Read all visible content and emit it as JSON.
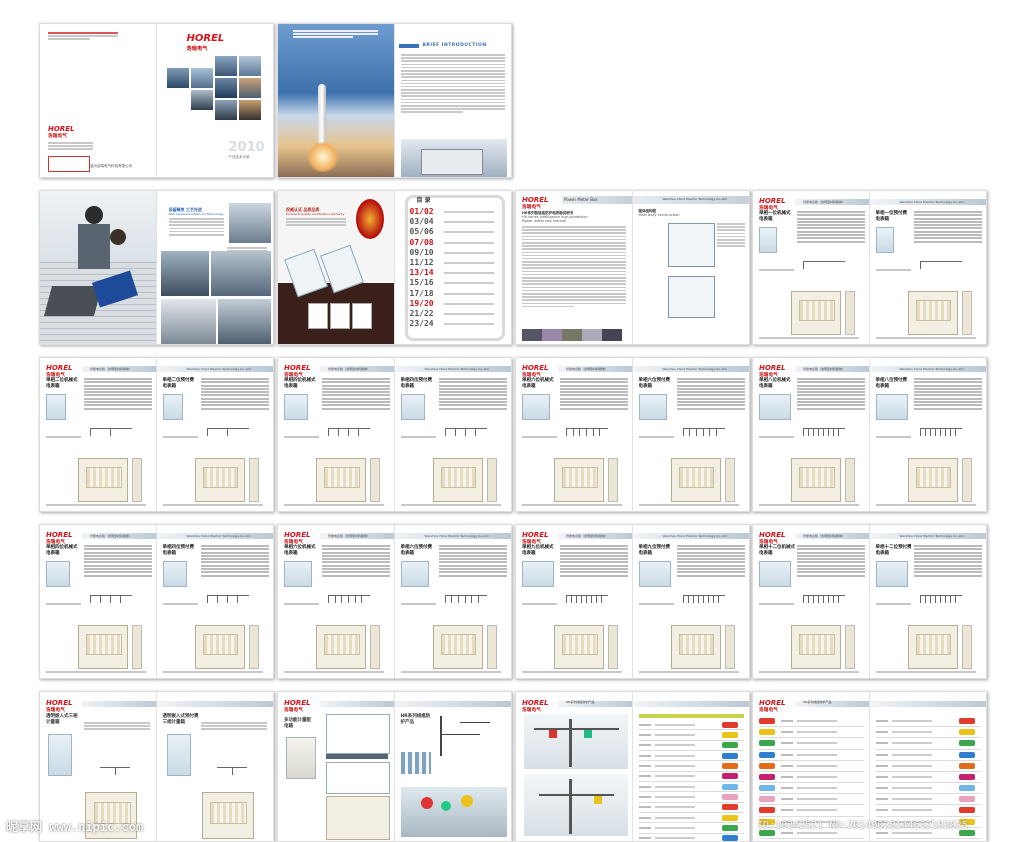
{
  "brand": {
    "logo": "HOREL",
    "logo_cn": "浩瑞电气"
  },
  "cover": {
    "company": "温州浩瑞电气科技有限公司",
    "year": "2010",
    "catalog": "产品技术手册",
    "intro_title": "BRIEF INTRODUCTION"
  },
  "spreads": {
    "s4_left_title": "设备精良 工艺先进",
    "s4_left_sub": "Well-equipped Advanced Technology",
    "s5_left_title": "权威认证 品质品质",
    "s5_left_sub": "Excellent quality certification authority",
    "toc_title": "目 录",
    "toc": [
      "01/02",
      "03/04",
      "05/06",
      "07/08",
      "09/10",
      "11/12",
      "13/14",
      "15/16",
      "17/18",
      "19/20",
      "21/22",
      "23/24"
    ],
    "toc_highlight": [
      0,
      3,
      6,
      9
    ],
    "pmb_tab": "Power Meter Box",
    "pmb_title": "HR系列智能高防护电表箱说明书",
    "pmb_sub1": "HR series Intelligence high protection",
    "pmb_sub2": "Power meter box manual",
    "pmb_right_title": "箱体结构图",
    "pmb_right_sub": "Main body construction",
    "header_en": "Wenzhou Horui Electric Technology Co.,Ltd",
    "header_cn": "智能电表箱（透明型材料箱体）"
  },
  "product_pages": [
    [
      "单相一位机械式",
      "单相一位预付费"
    ],
    [
      "单相二位机械式",
      "单相二位预付费"
    ],
    [
      "单相四位机械式",
      "单相四位预付费"
    ],
    [
      "单相六位机械式",
      "单相六位预付费"
    ],
    [
      "单相八位机械式",
      "单相八位预付费"
    ],
    [
      "单相四位机械式",
      "单相四位预付费"
    ],
    [
      "单相六位机械式",
      "单相六位预付费"
    ],
    [
      "单相九位机械式",
      "单相九位预付费"
    ],
    [
      "单相十二位机械式",
      "单相十二位预付费"
    ]
  ],
  "product_suffix": "电表箱",
  "last_row": {
    "s1_left": "透明嵌入式三相计量箱",
    "s1_right": "透明嵌入式预付费三相计量箱",
    "s2_left": "多功能计量配电箱",
    "s2_right": "HR系列线缆防护产品",
    "s3_header": "HR系列线缆防护产品",
    "s4_header": "HR系列线缆防护产品"
  },
  "watermark": {
    "left": "昵享网 www.nipic.com",
    "right": "ID:10342521 NO:20140028144632193025"
  }
}
